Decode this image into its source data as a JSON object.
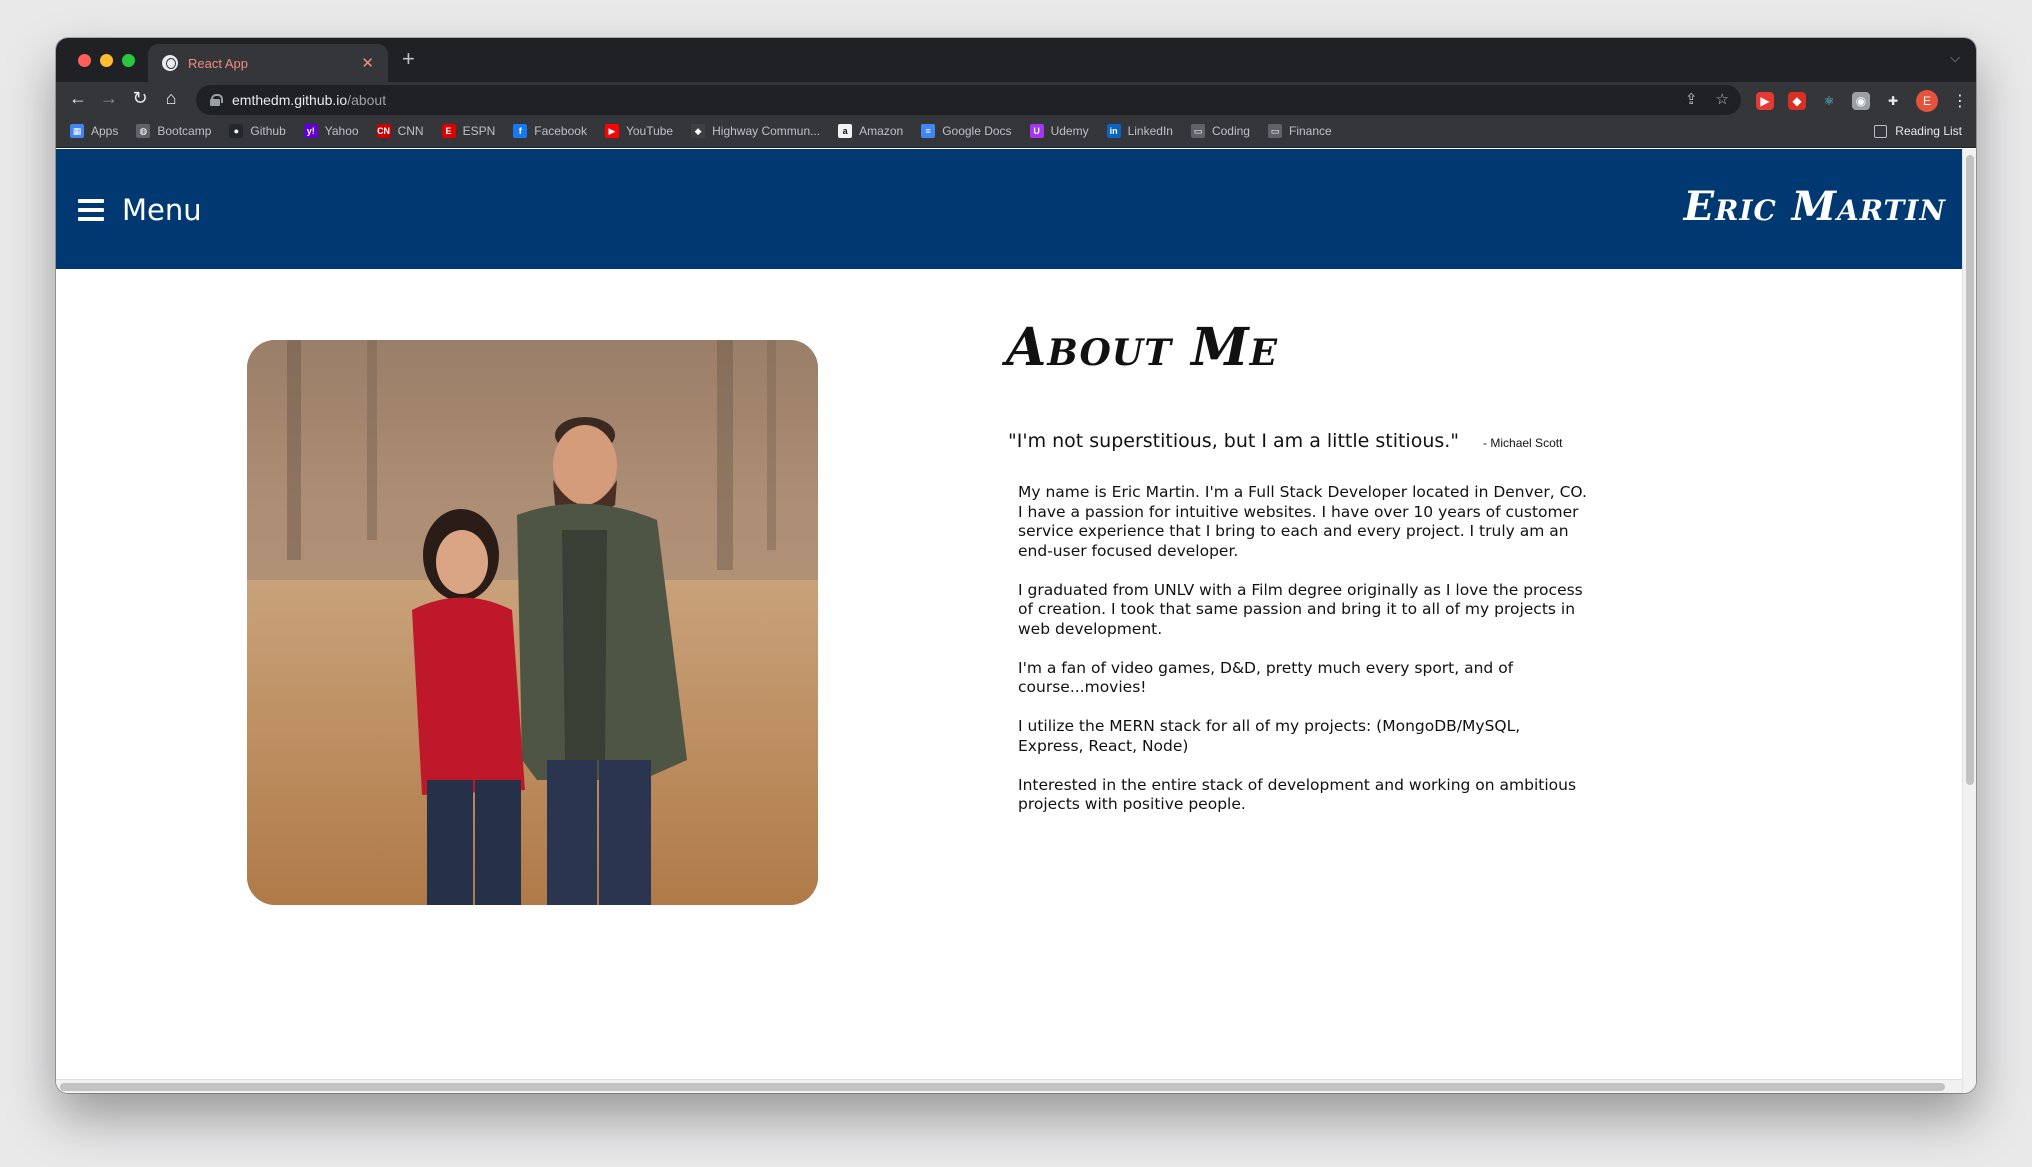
{
  "browser": {
    "tab_title": "React App",
    "url_host": "emthedm.github.io",
    "url_path": "/about",
    "avatar_letter": "E",
    "reading_list_label": "Reading List",
    "bookmarks": [
      {
        "label": "Apps",
        "icon": "apps-grid-icon",
        "color": "#4285f4"
      },
      {
        "label": "Bootcamp",
        "icon": "globe-icon",
        "color": "#5f6368"
      },
      {
        "label": "Github",
        "icon": "github-icon",
        "color": "#24292e"
      },
      {
        "label": "Yahoo",
        "icon": "yahoo-icon",
        "color": "#6001d2"
      },
      {
        "label": "CNN",
        "icon": "cnn-icon",
        "color": "#cc0000"
      },
      {
        "label": "ESPN",
        "icon": "espn-icon",
        "color": "#d00"
      },
      {
        "label": "Facebook",
        "icon": "facebook-icon",
        "color": "#1877f2"
      },
      {
        "label": "YouTube",
        "icon": "youtube-icon",
        "color": "#ff0000"
      },
      {
        "label": "Highway Commun...",
        "icon": "highway-icon",
        "color": "#3c4043"
      },
      {
        "label": "Amazon",
        "icon": "amazon-icon",
        "color": "#f2f2f2"
      },
      {
        "label": "Google Docs",
        "icon": "google-docs-icon",
        "color": "#4285f4"
      },
      {
        "label": "Udemy",
        "icon": "udemy-icon",
        "color": "#a435f0"
      },
      {
        "label": "LinkedIn",
        "icon": "linkedin-icon",
        "color": "#0a66c2"
      },
      {
        "label": "Coding",
        "icon": "folder-icon",
        "color": "#5f6368"
      },
      {
        "label": "Finance",
        "icon": "folder-icon",
        "color": "#5f6368"
      }
    ]
  },
  "site": {
    "menu_label": "Menu",
    "name": "Eric Martin",
    "header_color": "#003972"
  },
  "about": {
    "title": "About Me",
    "quote": "\"I'm not superstitious, but I am a little stitious.\"",
    "quote_author": "- Michael Scott",
    "paragraphs": [
      "My name is Eric Martin. I'm a Full Stack Developer located in Denver, CO. I have a passion for intuitive websites. I have over 10 years of customer service experience that I bring to each and every project. I truly am an end-user focused developer.",
      "I graduated from UNLV with a Film degree originally as I love the process of creation. I took that same passion and bring it to all of my projects in web development.",
      "I'm a fan of video games, D&D, pretty much every sport, and of course...movies!",
      "I utilize the MERN stack for all of my projects: (MongoDB/MySQL, Express, React, Node)",
      "Interested in the entire stack of development and working on ambitious projects with positive people."
    ]
  }
}
